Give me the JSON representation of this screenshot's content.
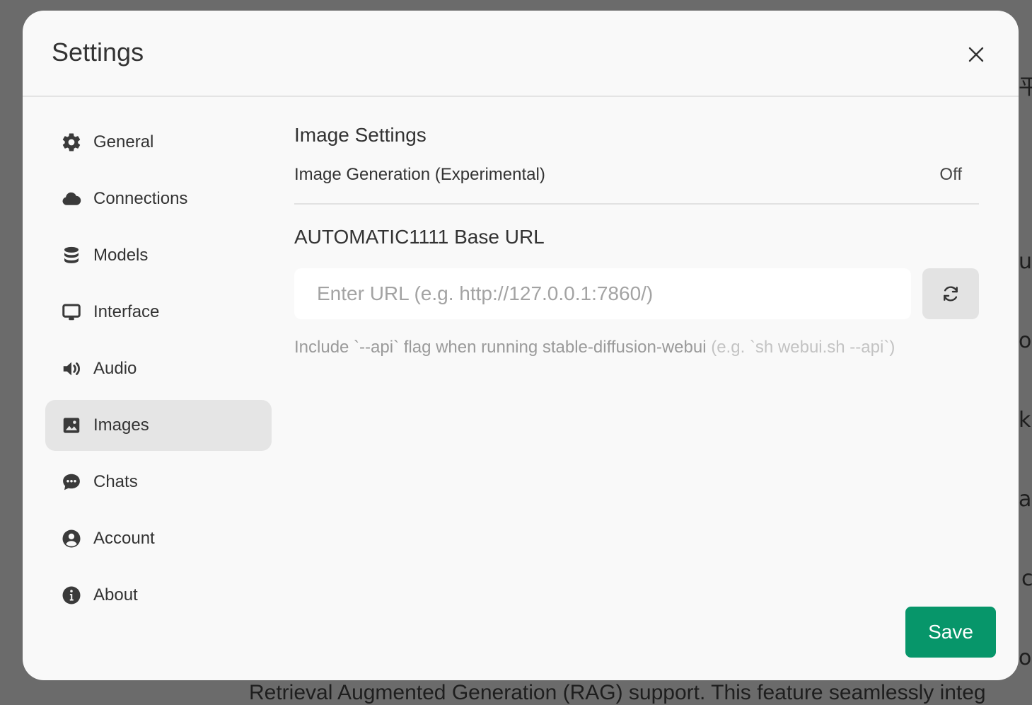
{
  "modal": {
    "title": "Settings"
  },
  "sidebar": {
    "items": [
      {
        "label": "General",
        "icon": "gear-icon"
      },
      {
        "label": "Connections",
        "icon": "cloud-icon"
      },
      {
        "label": "Models",
        "icon": "database-icon"
      },
      {
        "label": "Interface",
        "icon": "monitor-icon"
      },
      {
        "label": "Audio",
        "icon": "speaker-icon"
      },
      {
        "label": "Images",
        "icon": "image-icon",
        "active": true
      },
      {
        "label": "Chats",
        "icon": "chat-bubble-icon"
      },
      {
        "label": "Account",
        "icon": "user-circle-icon"
      },
      {
        "label": "About",
        "icon": "info-icon"
      }
    ]
  },
  "content": {
    "section_title": "Image Settings",
    "image_generation": {
      "label": "Image Generation (Experimental)",
      "value": "Off"
    },
    "base_url": {
      "title": "AUTOMATIC1111 Base URL",
      "value": "",
      "placeholder": "Enter URL (e.g. http://127.0.0.1:7860/)"
    },
    "hint": {
      "text": "Include `--api` flag when running stable-diffusion-webui ",
      "example": "(e.g. `sh webui.sh --api`)"
    }
  },
  "footer": {
    "save_label": "Save"
  },
  "background": {
    "glyphs": [
      "平",
      "u",
      "o",
      "k",
      "a",
      "c",
      "o"
    ],
    "bottom_text": "Retrieval Augmented Generation (RAG) support. This feature seamlessly integ"
  },
  "colors": {
    "accent": "#07966a",
    "active_nav": "#e5e5e5",
    "modal_bg": "#f9f9f9",
    "overlay": "#6b6b6b"
  }
}
